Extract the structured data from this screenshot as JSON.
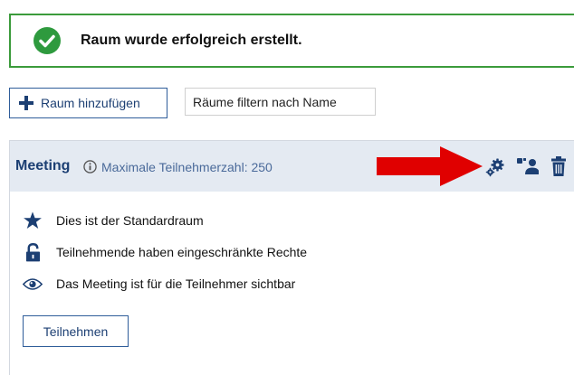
{
  "alert": {
    "message": "Raum wurde erfolgreich erstellt.",
    "icon": "check-circle-icon",
    "color": "#3b9b3b"
  },
  "toolbar": {
    "add_label": "Raum hinzufügen",
    "filter_placeholder": "Räume filtern nach Name"
  },
  "room": {
    "name": "Meeting",
    "max_participants_text": "Maximale Teilnehmerzahl: 250",
    "actions": [
      "gear-icon",
      "users-icon",
      "trash-icon"
    ],
    "properties": [
      {
        "icon": "star-icon",
        "label": "Dies ist der Standardraum"
      },
      {
        "icon": "lock-open-icon",
        "label": "Teilnehmende haben eingeschränkte Rechte"
      },
      {
        "icon": "eye-icon",
        "label": "Das Meeting ist für die Teilnehmer sichtbar"
      }
    ],
    "join_label": "Teilnehmen"
  },
  "colors": {
    "accent": "#1c3f73",
    "header_bg": "#e4eaf2",
    "arrow": "#e00000"
  }
}
